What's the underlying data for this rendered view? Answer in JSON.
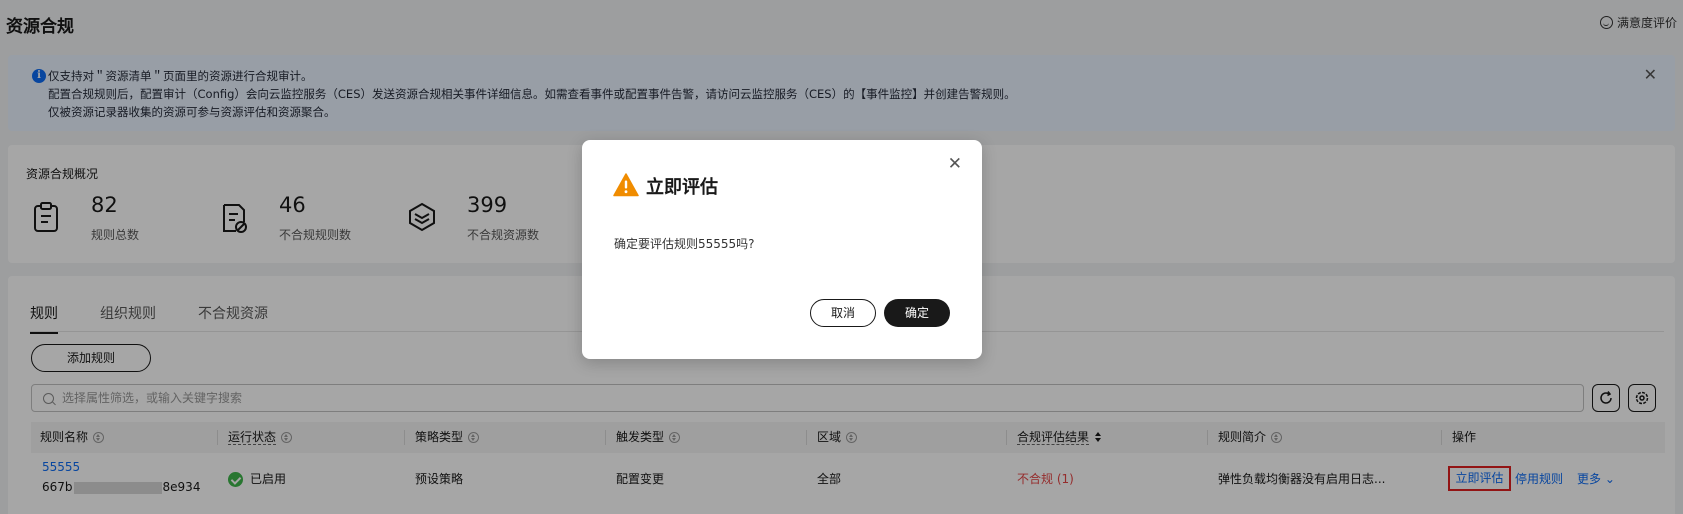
{
  "page": {
    "title": "资源合规",
    "feedback_label": "满意度评价"
  },
  "banner": {
    "lines": [
      "仅支持对＂资源清单＂页面里的资源进行合规审计。",
      "配置合规规则后，配置审计（Config）会向云监控服务（CES）发送资源合规相关事件详细信息。如需查看事件或配置事件告警，请访问云监控服务（CES）的【事件监控】并创建告警规则。",
      "仅被资源记录器收集的资源可参与资源评估和资源聚合。"
    ]
  },
  "overview": {
    "title": "资源合规概况",
    "stats": [
      {
        "value": "82",
        "label": "规则总数",
        "icon": "clipboard-icon"
      },
      {
        "value": "46",
        "label": "不合规规则数",
        "icon": "noncompliant-doc-icon"
      },
      {
        "value": "399",
        "label": "不合规资源数",
        "icon": "layers-icon"
      }
    ]
  },
  "rules": {
    "tabs": [
      "规则",
      "组织规则",
      "不合规资源"
    ],
    "add_button": "添加规则",
    "search_placeholder": "选择属性筛选，或输入关键字搜索",
    "columns": [
      "规则名称",
      "运行状态",
      "策略类型",
      "触发类型",
      "区域",
      "合规评估结果",
      "规则简介",
      "操作"
    ],
    "row": {
      "name": "55555",
      "id_prefix": "667b",
      "id_suffix": "8e934",
      "status": "已启用",
      "policy_type": "预设策略",
      "trigger_type": "配置变更",
      "region": "全部",
      "result": "不合规 (1)",
      "description": "弹性负载均衡器没有启用日志...",
      "actions": {
        "evaluate": "立即评估",
        "disable": "停用规则",
        "more": "更多"
      }
    }
  },
  "dialog": {
    "title": "立即评估",
    "message": "确定要评估规则55555吗?",
    "cancel": "取消",
    "confirm": "确定"
  },
  "colors": {
    "accent": "#0d6cf5",
    "danger": "#e54545",
    "success": "#3eb54a",
    "warning": "#f08c00",
    "highlight_border": "#e02020"
  }
}
